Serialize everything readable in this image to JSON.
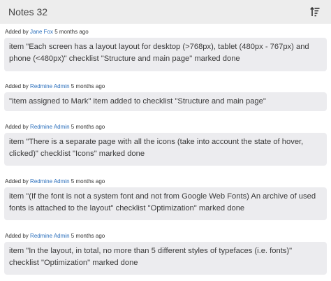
{
  "header": {
    "title": "Notes 32",
    "sort_icon": "sort-descending-icon"
  },
  "notes": [
    {
      "prefix": "Added by",
      "author": "Jane Fox",
      "time": "5 months ago",
      "text": "item \"Each screen has a layout layout for desktop (>768px), tablet (480px - 767px) and phone (<480px)\" checklist \"Structure and main page\" marked done"
    },
    {
      "prefix": "Added by",
      "author": "Redmine Admin",
      "time": "5 months ago",
      "text": "\"item assigned to Mark\" item added to checklist \"Structure and main page\""
    },
    {
      "prefix": "Added by",
      "author": "Redmine Admin",
      "time": "5 months ago",
      "text": "item \"There is a separate page with all the icons (take into account the state of hover, clicked)\" checklist \"Icons\" marked done"
    },
    {
      "prefix": "Added by",
      "author": "Redmine Admin",
      "time": "5 months ago",
      "text": "item \"(If the font is not a system font and not from Google Web Fonts) An archive of used fonts is attached to the layout\" checklist \"Optimization\" marked done"
    },
    {
      "prefix": "Added by",
      "author": "Redmine Admin",
      "time": "5 months ago",
      "text": "item \"In the layout, in total, no more than 5 different styles of typefaces (i.e. fonts)\" checklist \"Optimization\" marked done"
    }
  ]
}
